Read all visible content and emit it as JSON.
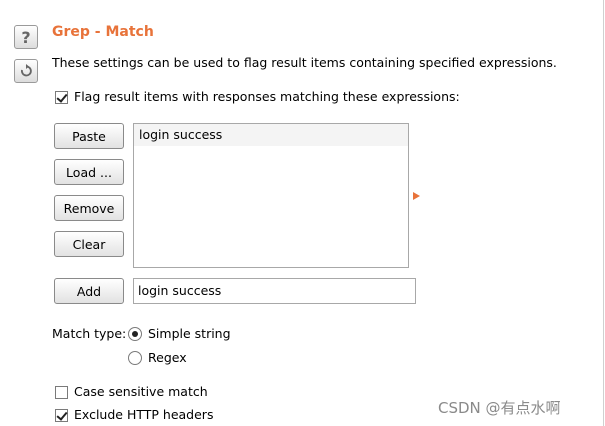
{
  "side_buttons": {
    "help_label": "?"
  },
  "header": {
    "title": "Grep - Match",
    "description": "These settings can be used to flag result items containing specified expressions."
  },
  "flag_option": {
    "label": "Flag result items with responses matching these expressions:",
    "checked": true
  },
  "list_buttons": {
    "paste": "Paste",
    "load": "Load ...",
    "remove": "Remove",
    "clear": "Clear"
  },
  "expressions": [
    "login success"
  ],
  "add": {
    "button_label": "Add",
    "input_value": "login success"
  },
  "match_type": {
    "label": "Match type:",
    "options": [
      {
        "label": "Simple string",
        "selected": true
      },
      {
        "label": "Regex",
        "selected": false
      }
    ]
  },
  "options": {
    "case_sensitive": {
      "label": "Case sensitive match",
      "checked": false
    },
    "exclude_headers": {
      "label": "Exclude HTTP headers",
      "checked": true
    }
  },
  "watermark": "CSDN @有点水啊",
  "colors": {
    "accent": "#e8733a"
  }
}
